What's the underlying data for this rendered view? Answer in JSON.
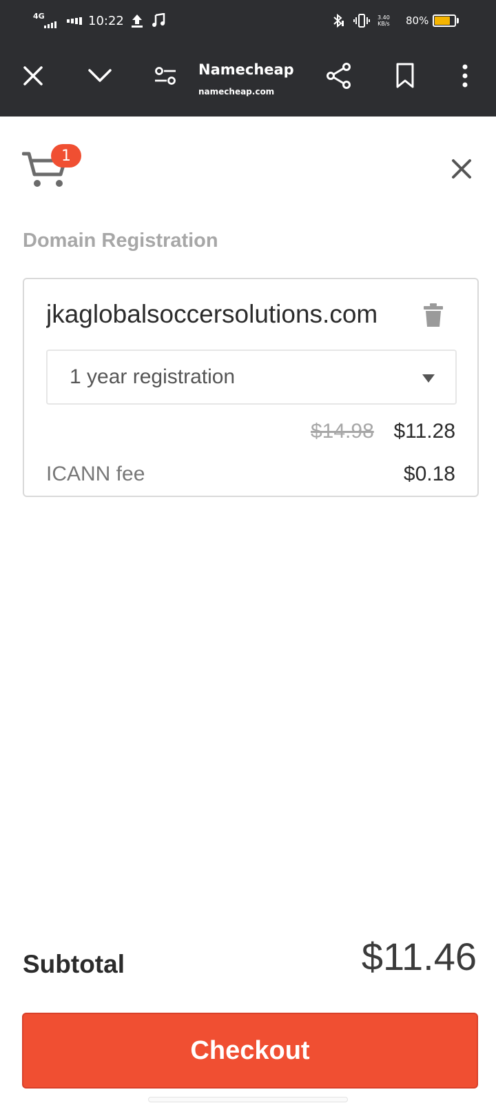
{
  "status_bar": {
    "network": "4G",
    "time": "10:22",
    "speed_top": "3.40",
    "speed_bottom": "KB/s",
    "battery_text": "80%",
    "battery_level_percent": 80,
    "battery_color": "#f5b400"
  },
  "browser": {
    "site_title": "Namecheap",
    "site_url": "namecheap.com"
  },
  "cart": {
    "count": "1",
    "badge_color": "#f04f32"
  },
  "section": {
    "title": "Domain Registration"
  },
  "item": {
    "domain": "jkaglobalsoccersolutions.com",
    "term": "1 year registration",
    "old_price": "$14.98",
    "price": "$11.28",
    "fee_label": "ICANN fee",
    "fee_value": "$0.18"
  },
  "summary": {
    "subtotal_label": "Subtotal",
    "subtotal_value": "$11.46",
    "checkout_label": "Checkout",
    "checkout_color": "#f04f32"
  }
}
